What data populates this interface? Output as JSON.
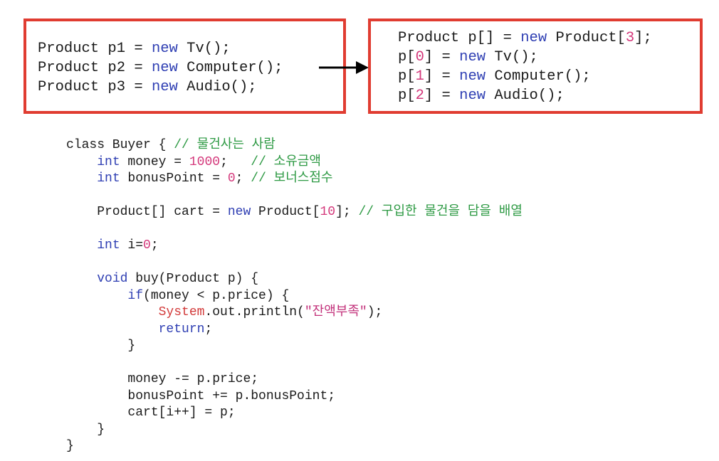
{
  "left_box": {
    "lines": [
      [
        {
          "t": "Product p1 = ",
          "c": ""
        },
        {
          "t": "new",
          "c": "kw"
        },
        {
          "t": " Tv();",
          "c": ""
        }
      ],
      [
        {
          "t": "Product p2 = ",
          "c": ""
        },
        {
          "t": "new",
          "c": "kw"
        },
        {
          "t": " Computer();",
          "c": ""
        }
      ],
      [
        {
          "t": "Product p3 = ",
          "c": ""
        },
        {
          "t": "new",
          "c": "kw"
        },
        {
          "t": " Audio();",
          "c": ""
        }
      ]
    ]
  },
  "right_box": {
    "lines": [
      [
        {
          "t": "Product p[] = ",
          "c": ""
        },
        {
          "t": "new",
          "c": "kw"
        },
        {
          "t": " Product[",
          "c": ""
        },
        {
          "t": "3",
          "c": "num"
        },
        {
          "t": "];",
          "c": ""
        }
      ],
      [
        {
          "t": "p[",
          "c": ""
        },
        {
          "t": "0",
          "c": "num"
        },
        {
          "t": "] = ",
          "c": ""
        },
        {
          "t": "new",
          "c": "kw"
        },
        {
          "t": " Tv();",
          "c": ""
        }
      ],
      [
        {
          "t": "p[",
          "c": ""
        },
        {
          "t": "1",
          "c": "num"
        },
        {
          "t": "] = ",
          "c": ""
        },
        {
          "t": "new",
          "c": "kw"
        },
        {
          "t": " Computer();",
          "c": ""
        }
      ],
      [
        {
          "t": "p[",
          "c": ""
        },
        {
          "t": "2",
          "c": "num"
        },
        {
          "t": "] = ",
          "c": ""
        },
        {
          "t": "new",
          "c": "kw"
        },
        {
          "t": " Audio();",
          "c": ""
        }
      ]
    ]
  },
  "code": {
    "lines": [
      [
        {
          "t": "class Buyer { ",
          "c": ""
        },
        {
          "t": "// 물건사는 사람",
          "c": "cm"
        }
      ],
      [
        {
          "t": "    ",
          "c": ""
        },
        {
          "t": "int",
          "c": "kw"
        },
        {
          "t": " money = ",
          "c": ""
        },
        {
          "t": "1000",
          "c": "num"
        },
        {
          "t": ";   ",
          "c": ""
        },
        {
          "t": "// 소유금액",
          "c": "cm"
        }
      ],
      [
        {
          "t": "    ",
          "c": ""
        },
        {
          "t": "int",
          "c": "kw"
        },
        {
          "t": " bonusPoint = ",
          "c": ""
        },
        {
          "t": "0",
          "c": "num"
        },
        {
          "t": "; ",
          "c": ""
        },
        {
          "t": "// 보너스점수",
          "c": "cm"
        }
      ],
      [
        {
          "t": "",
          "c": ""
        }
      ],
      [
        {
          "t": "    Product[] cart = ",
          "c": ""
        },
        {
          "t": "new",
          "c": "kw"
        },
        {
          "t": " Product[",
          "c": ""
        },
        {
          "t": "10",
          "c": "num"
        },
        {
          "t": "]; ",
          "c": ""
        },
        {
          "t": "// 구입한 물건을 담을 배열",
          "c": "cm"
        }
      ],
      [
        {
          "t": "",
          "c": ""
        }
      ],
      [
        {
          "t": "    ",
          "c": ""
        },
        {
          "t": "int",
          "c": "kw"
        },
        {
          "t": " i=",
          "c": ""
        },
        {
          "t": "0",
          "c": "num"
        },
        {
          "t": ";",
          "c": ""
        }
      ],
      [
        {
          "t": "",
          "c": ""
        }
      ],
      [
        {
          "t": "    ",
          "c": ""
        },
        {
          "t": "void",
          "c": "kw"
        },
        {
          "t": " buy(Product p) {",
          "c": ""
        }
      ],
      [
        {
          "t": "        ",
          "c": ""
        },
        {
          "t": "if",
          "c": "kw"
        },
        {
          "t": "(money < p.price) {",
          "c": ""
        }
      ],
      [
        {
          "t": "            ",
          "c": ""
        },
        {
          "t": "System",
          "c": "sys"
        },
        {
          "t": ".out.println(",
          "c": ""
        },
        {
          "t": "\"잔액부족\"",
          "c": "str"
        },
        {
          "t": ");",
          "c": ""
        }
      ],
      [
        {
          "t": "            ",
          "c": ""
        },
        {
          "t": "return",
          "c": "kw"
        },
        {
          "t": ";",
          "c": ""
        }
      ],
      [
        {
          "t": "        }",
          "c": ""
        }
      ],
      [
        {
          "t": "",
          "c": ""
        }
      ],
      [
        {
          "t": "        money -= p.price;",
          "c": ""
        }
      ],
      [
        {
          "t": "        bonusPoint += p.bonusPoint;",
          "c": ""
        }
      ],
      [
        {
          "t": "        cart[i++] = p;",
          "c": ""
        }
      ],
      [
        {
          "t": "    }",
          "c": ""
        }
      ],
      [
        {
          "t": "}",
          "c": ""
        }
      ]
    ]
  }
}
